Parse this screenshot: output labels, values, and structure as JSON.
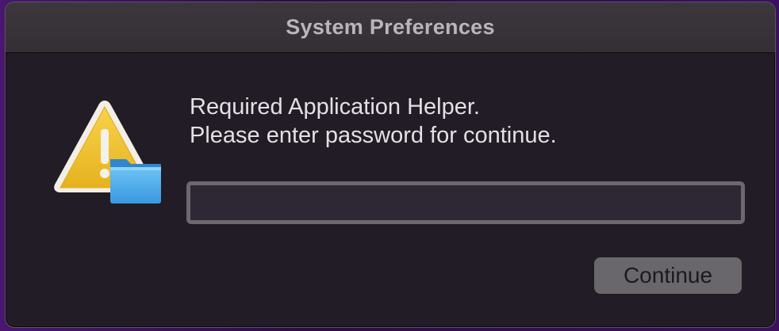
{
  "window": {
    "title": "System Preferences"
  },
  "dialog": {
    "icon": "warning-folder-icon",
    "message_line1": "Required Application Helper.",
    "message_line2": "Please enter password for continue.",
    "password_value": "",
    "continue_label": "Continue"
  },
  "colors": {
    "window_bg": "#211c25",
    "titlebar_bg": "#3b373d",
    "warning_yellow": "#f2c230",
    "folder_blue": "#4aa9ec",
    "button_bg": "#6a676c"
  }
}
